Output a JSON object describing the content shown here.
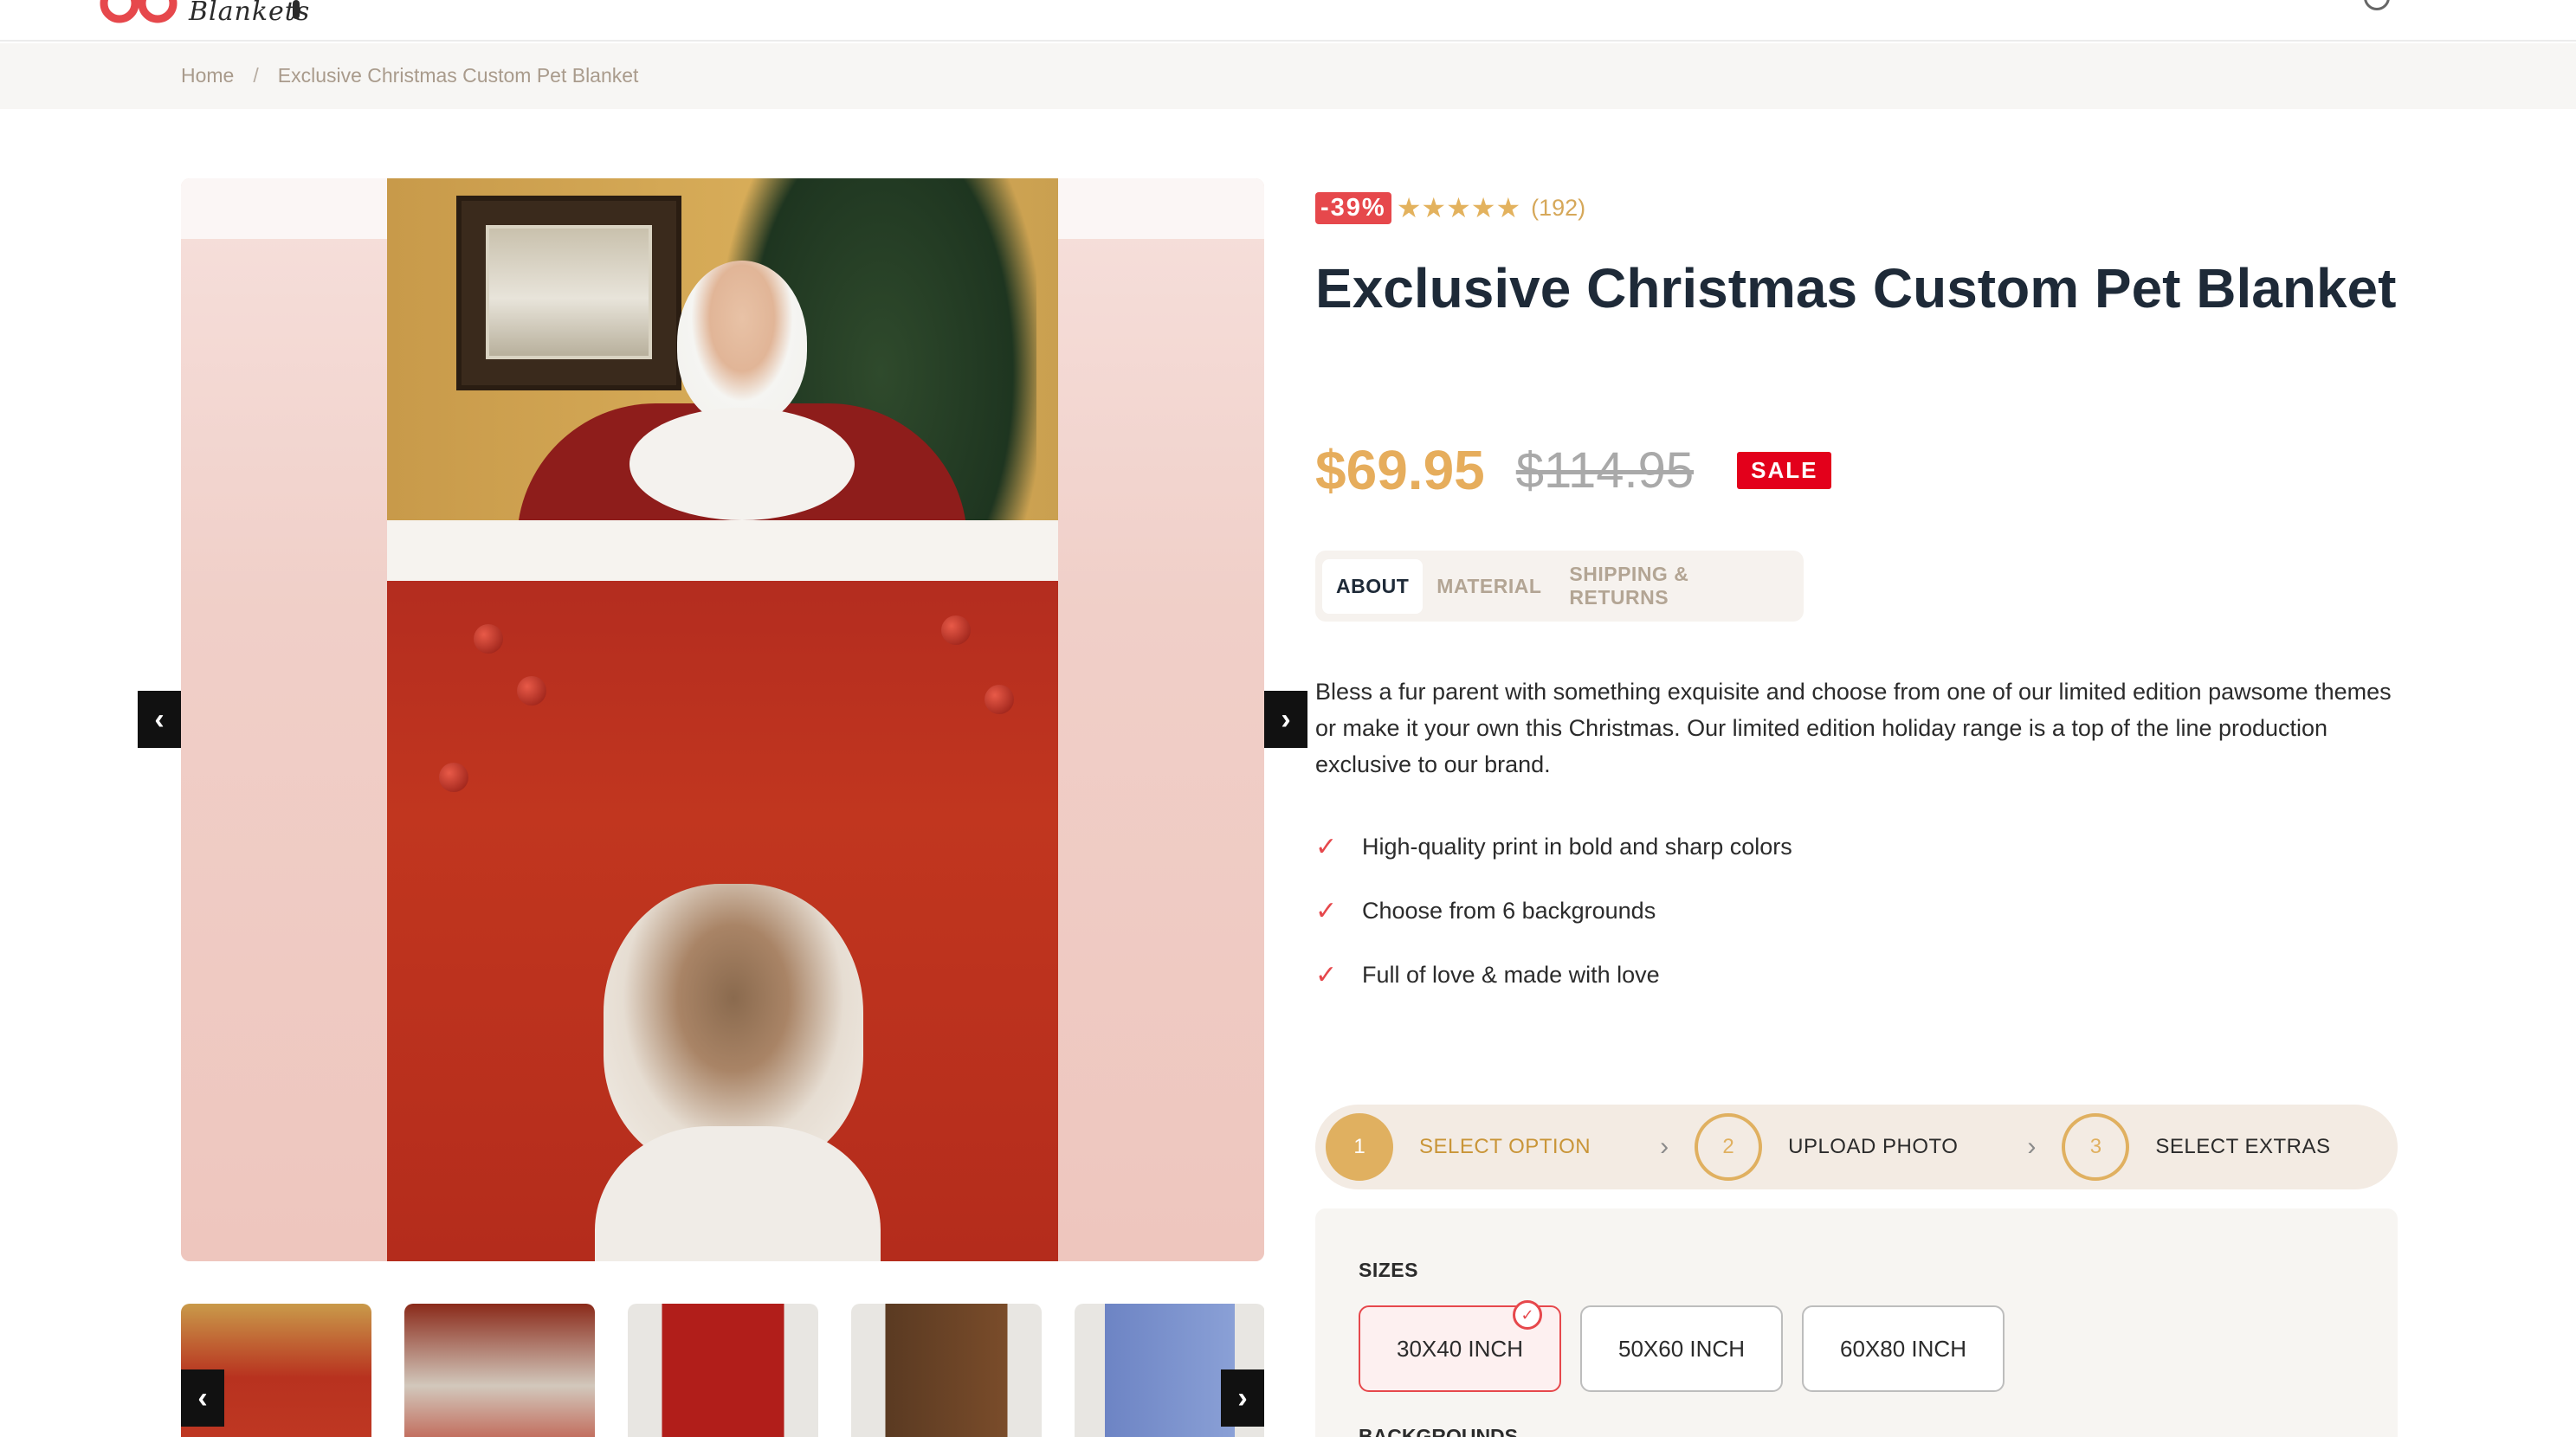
{
  "header": {
    "logo_text": "Blankets"
  },
  "breadcrumb": {
    "home": "Home",
    "separator": "/",
    "current": "Exclusive Christmas Custom Pet Blanket"
  },
  "gallery": {
    "prev_icon": "chevron-left-icon",
    "next_icon": "chevron-right-icon",
    "thumbnail_count": 5
  },
  "product": {
    "discount_badge": "-39%",
    "stars": "★★★★★",
    "rating": 5,
    "review_count": "(192)",
    "title": "Exclusive Christmas Custom Pet Blanket",
    "price": "$69.95",
    "old_price": "$114.95",
    "sale_badge": "SALE"
  },
  "tabs": [
    {
      "label": "ABOUT",
      "active": true
    },
    {
      "label": "MATERIAL",
      "active": false
    },
    {
      "label": "SHIPPING & RETURNS",
      "active": false
    }
  ],
  "description": "Bless a fur parent with something exquisite and choose from one of our limited edition pawsome themes or make it your own this Christmas. Our limited edition holiday range is a top of the line production exclusive to our brand.",
  "features": [
    "High-quality print in bold and sharp colors",
    "Choose from 6 backgrounds",
    "Full of love & made with love"
  ],
  "steps": [
    {
      "number": "1",
      "label": "SELECT OPTION",
      "active": true
    },
    {
      "number": "2",
      "label": "UPLOAD PHOTO",
      "active": false
    },
    {
      "number": "3",
      "label": "SELECT EXTRAS",
      "active": false
    }
  ],
  "options": {
    "sizes_label": "SIZES",
    "sizes": [
      "30X40 INCH",
      "50X60 INCH",
      "60X80 INCH"
    ],
    "selected_size": "30X40 INCH",
    "backgrounds_label": "BACKGROUNDS"
  },
  "colors": {
    "accent_gold": "#e0b060",
    "discount_red": "#e6484c",
    "sale_red": "#e3001b",
    "title_navy": "#1e2a38"
  }
}
